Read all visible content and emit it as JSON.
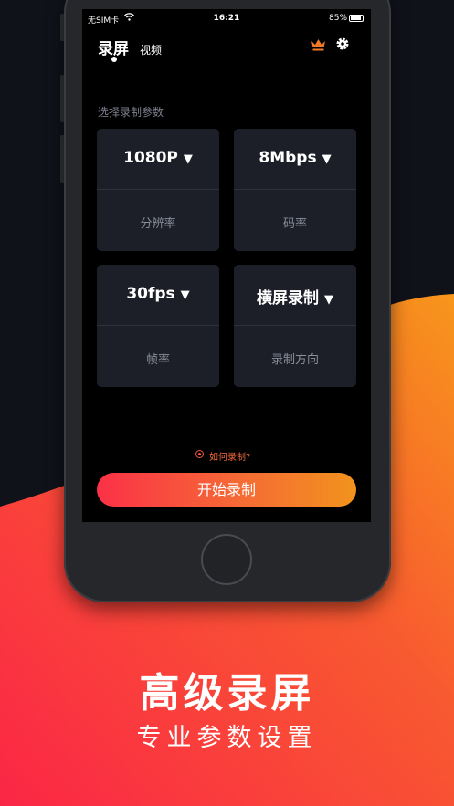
{
  "status_bar": {
    "carrier": "无SIM卡",
    "time": "16:21",
    "battery": "85%"
  },
  "header": {
    "tab_record": "录屏",
    "tab_video": "视频"
  },
  "section_label": "选择录制参数",
  "params": [
    {
      "value": "1080P",
      "label": "分辨率"
    },
    {
      "value": "8Mbps",
      "label": "码率"
    },
    {
      "value": "30fps",
      "label": "帧率"
    },
    {
      "value": "横屏录制",
      "label": "录制方向"
    }
  ],
  "howto": "如何录制?",
  "start_button": "开始录制",
  "promo": {
    "headline": "高级录屏",
    "subline": "专业参数设置"
  },
  "colors": {
    "accent_start": "#fb3147",
    "accent_end": "#f2931d",
    "crown": "#f07a2a"
  },
  "icons": {
    "dropdown": "triangle-down-icon",
    "crown": "crown-icon",
    "settings": "gear-icon"
  }
}
